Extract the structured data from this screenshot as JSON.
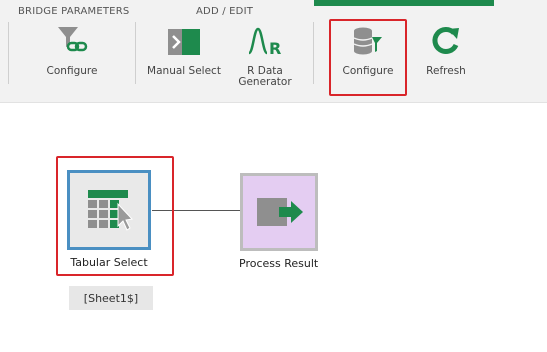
{
  "ribbon": {
    "groups": {
      "bridge": "BRIDGE PARAMETERS",
      "add_edit": "ADD / EDIT"
    },
    "buttons": {
      "configure_bridge": "Configure",
      "manual_select": "Manual Select",
      "r_data_line1": "R Data",
      "r_data_line2": "Generator",
      "configure": "Configure",
      "refresh": "Refresh"
    },
    "accent_color": "#1e8a4d"
  },
  "canvas": {
    "tabular_select": "Tabular Select",
    "process_result": "Process Result",
    "sheet_tag": "[Sheet1$]"
  },
  "colors": {
    "highlight": "#d9252a",
    "process_fill": "#e4cdf2",
    "tabular_border": "#4a8fc2",
    "icon_green": "#1e8a4d",
    "icon_gray": "#8f8f8f"
  }
}
